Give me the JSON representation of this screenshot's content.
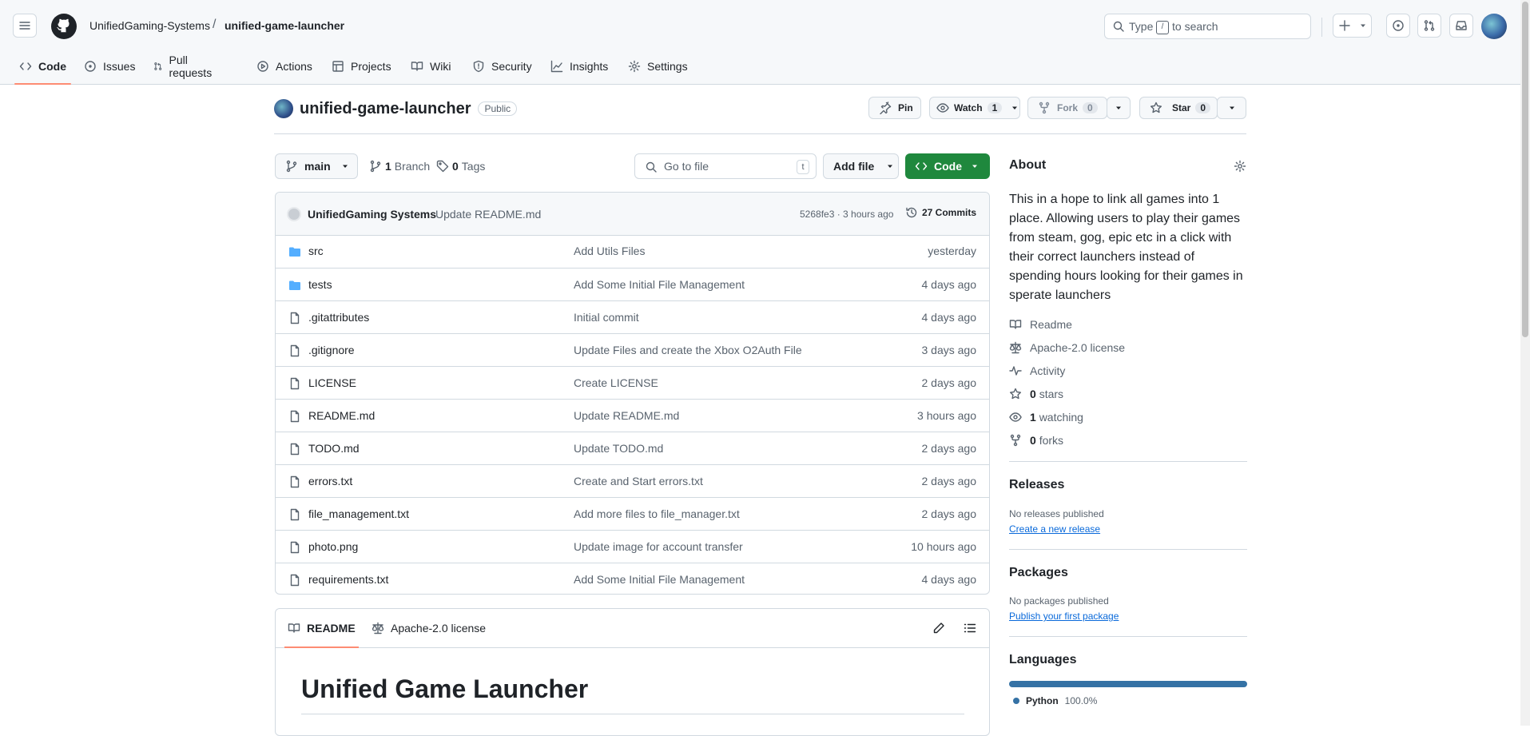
{
  "header": {
    "owner": "UnifiedGaming-Systems",
    "separator": "/",
    "repo": "unified-game-launcher",
    "search_prefix": "Type",
    "search_key": "/",
    "search_suffix": "to search"
  },
  "nav_tabs": [
    "Code",
    "Issues",
    "Pull requests",
    "Actions",
    "Projects",
    "Wiki",
    "Security",
    "Insights",
    "Settings"
  ],
  "repo": {
    "name": "unified-game-launcher",
    "visibility": "Public",
    "pin_label": "Pin",
    "watch_label": "Watch",
    "watch_count": "1",
    "fork_label": "Fork",
    "fork_count": "0",
    "star_label": "Star",
    "star_count": "0"
  },
  "toolbar": {
    "branch": "main",
    "branches_count": "1",
    "branches_label": "Branch",
    "tags_count": "0",
    "tags_label": "Tags",
    "goto_placeholder": "Go to file",
    "goto_key": "t",
    "add_file_label": "Add file",
    "code_label": "Code"
  },
  "latest_commit": {
    "author": "UnifiedGaming Systems",
    "message": "Update README.md",
    "sha_time": "5268fe3 · 3 hours ago",
    "commits_count": "27 Commits"
  },
  "files": [
    {
      "name": "src",
      "type": "dir",
      "message": "Add Utils Files",
      "date": "yesterday"
    },
    {
      "name": "tests",
      "type": "dir",
      "message": "Add Some Initial File Management",
      "date": "4 days ago"
    },
    {
      "name": ".gitattributes",
      "type": "file",
      "message": "Initial commit",
      "date": "4 days ago"
    },
    {
      "name": ".gitignore",
      "type": "file",
      "message": "Update Files and create the Xbox O2Auth File",
      "date": "3 days ago"
    },
    {
      "name": "LICENSE",
      "type": "file",
      "message": "Create LICENSE",
      "date": "2 days ago"
    },
    {
      "name": "README.md",
      "type": "file",
      "message": "Update README.md",
      "date": "3 hours ago"
    },
    {
      "name": "TODO.md",
      "type": "file",
      "message": "Update TODO.md",
      "date": "2 days ago"
    },
    {
      "name": "errors.txt",
      "type": "file",
      "message": "Create and Start errors.txt",
      "date": "2 days ago"
    },
    {
      "name": "file_management.txt",
      "type": "file",
      "message": "Add more files to file_manager.txt",
      "date": "2 days ago"
    },
    {
      "name": "photo.png",
      "type": "file",
      "message": "Update image for account transfer",
      "date": "10 hours ago"
    },
    {
      "name": "requirements.txt",
      "type": "file",
      "message": "Add Some Initial File Management",
      "date": "4 days ago"
    }
  ],
  "readme": {
    "tab_readme": "README",
    "tab_license": "Apache-2.0 license",
    "heading": "Unified Game Launcher"
  },
  "about": {
    "title": "About",
    "description": "This in a hope to link all games into 1 place. Allowing users to play their games from steam, gog, epic etc in a click with their correct launchers instead of spending hours looking for their games in sperate launchers",
    "readme": "Readme",
    "license": "Apache-2.0 license",
    "activity": "Activity",
    "stars_count": "0",
    "stars_label": "stars",
    "watching_count": "1",
    "watching_label": "watching",
    "forks_count": "0",
    "forks_label": "forks"
  },
  "releases": {
    "title": "Releases",
    "empty": "No releases published",
    "link": "Create a new release"
  },
  "packages": {
    "title": "Packages",
    "empty": "No packages published",
    "link": "Publish your first package"
  },
  "languages": {
    "title": "Languages",
    "items": [
      {
        "name": "Python",
        "percent": "100.0%",
        "share": 1.0,
        "color": "#3572A5"
      }
    ]
  }
}
